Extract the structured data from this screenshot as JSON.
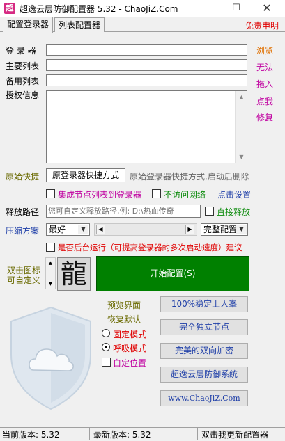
{
  "window": {
    "title": "超逸云层防御配置器 5.32  -  ChaoJiZ.Com",
    "logo_char": "超",
    "min_glyph": "—",
    "max_glyph": "☐",
    "close_glyph": "✕"
  },
  "tabs": [
    {
      "label": "配置登录器",
      "active": true
    },
    {
      "label": "列表配置器",
      "active": false
    }
  ],
  "disclaimer": "免责申明",
  "form": {
    "login_label": "登 录 器",
    "main_list_label": "主要列表",
    "backup_list_label": "备用列表",
    "auth_info_label": "授权信息",
    "login_value": "",
    "main_list_value": "",
    "backup_list_value": "",
    "auth_info_value": ""
  },
  "side_links": {
    "browse": "浏览",
    "invalid": "无法",
    "drag_in": "拖入",
    "click_me": "点我",
    "repair": "修复"
  },
  "shortcut": {
    "label": "原始快捷",
    "button": "原登录器快捷方式",
    "hint": "原始登录器快捷方式,启动后删除"
  },
  "options": {
    "integrate_nodes": "集成节点列表到登录器",
    "no_network": "不访问网络",
    "click_settings": "点击设置",
    "release_path_label": "释放路径",
    "release_path_placeholder": "您可自定义释放路径,例: D:\\热血传奇",
    "direct_release": "直接释放",
    "compress_label": "压缩方案",
    "compress_level": "最好",
    "compress_mode": "完整配置",
    "background_run": "是否后台运行（可提高登录器的多次启动速度）建议"
  },
  "icon_section": {
    "label_line1": "双击图标",
    "label_line2": "可自定义",
    "icon_char": "龍",
    "start_button": "开始配置(S)"
  },
  "preview": {
    "preview_ui": "预览界面",
    "restore_default": "恢复默认",
    "fixed_mode": "固定模式",
    "breath_mode": "呼吸模式",
    "custom_position": "自定位置"
  },
  "feature_buttons": [
    "100%稳定上人峯",
    "完全独立节点",
    "完美的双向加密",
    "超逸云层防御系统",
    "www.ChaoJiZ.Com"
  ],
  "status": {
    "current_version": "当前版本: 5.32",
    "latest_version": "最新版本: 5.32",
    "update_link": "双击我更新配置器"
  },
  "colors": {
    "start_button_bg": "#008000",
    "red_text": "#e00000",
    "blue_text": "#1f3fa8",
    "green_text": "#0a8a0a",
    "orange_link": "#e07000",
    "magenta_link": "#c000a0",
    "olive_label": "#6a6a00"
  }
}
